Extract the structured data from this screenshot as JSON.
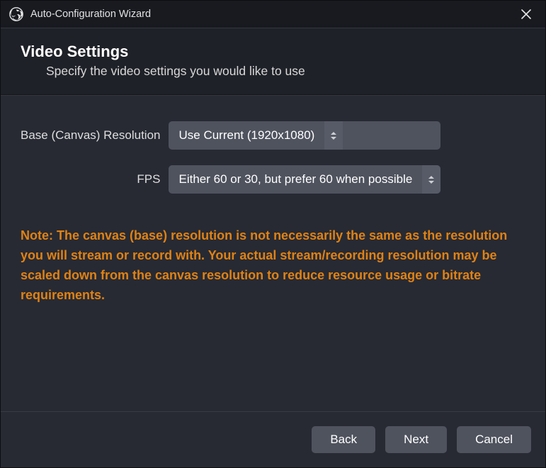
{
  "titlebar": {
    "title": "Auto-Configuration Wizard"
  },
  "header": {
    "title": "Video Settings",
    "subtitle": "Specify the video settings you would like to use"
  },
  "form": {
    "resolution": {
      "label": "Base (Canvas) Resolution",
      "value": "Use Current (1920x1080)"
    },
    "fps": {
      "label": "FPS",
      "value": "Either 60 or 30, but prefer 60 when possible"
    }
  },
  "note": "Note: The canvas (base) resolution is not necessarily the same as the resolution you will stream or record with. Your actual stream/recording resolution may be scaled down from the canvas resolution to reduce resource usage or bitrate requirements.",
  "footer": {
    "back": "Back",
    "next": "Next",
    "cancel": "Cancel"
  }
}
